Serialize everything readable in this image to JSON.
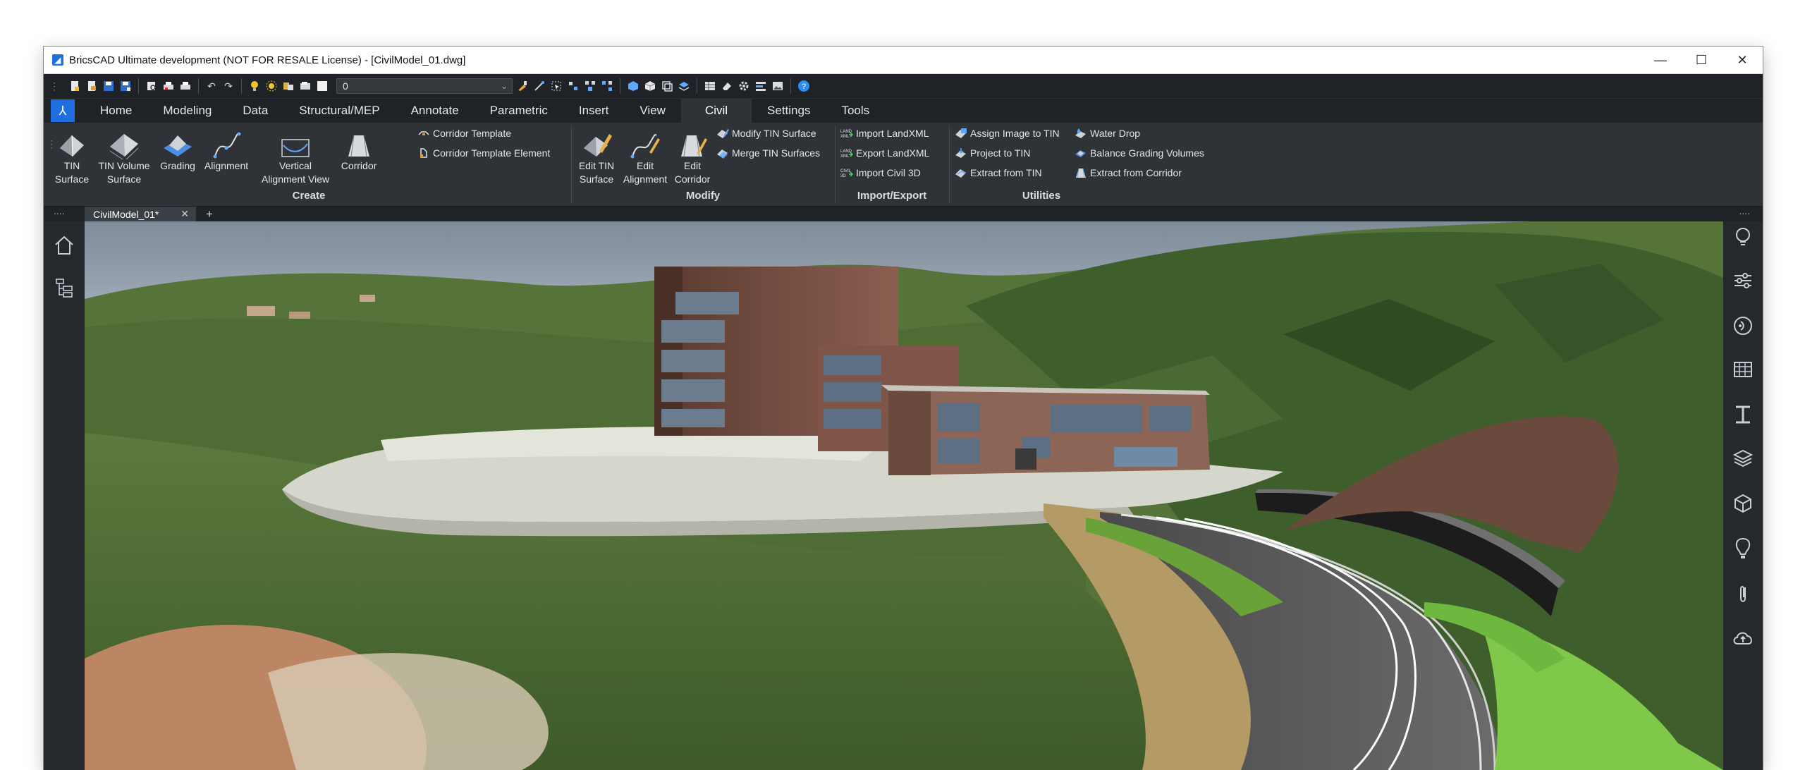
{
  "window": {
    "title": "BricsCAD Ultimate development (NOT FOR RESALE License) - [CivilModel_01.dwg]",
    "controls": {
      "minimize": "—",
      "maximize": "☐",
      "close": "✕"
    }
  },
  "qat": {
    "layer_value": "0",
    "icons": [
      "new-icon",
      "open-icon",
      "save-icon",
      "save-as-icon",
      "print-preview-icon",
      "plot-icon",
      "print-icon",
      "undo-icon",
      "redo-icon",
      "light-icon",
      "sun-icon",
      "layer-props-icon",
      "layer-state-icon",
      "color-swatch-icon",
      "match-props-icon",
      "pick-icon",
      "select-icon",
      "quick-select-icon",
      "select-similar-icon",
      "grip-icon",
      "view-cube-icon",
      "solid-icon",
      "render-icon",
      "layers-icon",
      "table-icon",
      "eraser-icon",
      "settings-icon",
      "draw-order-icon",
      "image-icon",
      "help-icon"
    ]
  },
  "tabs": [
    "Home",
    "Modeling",
    "Data",
    "Structural/MEP",
    "Annotate",
    "Parametric",
    "Insert",
    "View",
    "Civil",
    "Settings",
    "Tools"
  ],
  "active_tab": "Civil",
  "ribbon": {
    "create": {
      "title": "Create",
      "buttons": [
        {
          "label1": "TIN",
          "label2": "Surface"
        },
        {
          "label1": "TIN Volume",
          "label2": "Surface"
        },
        {
          "label1": "Grading",
          "label2": ""
        },
        {
          "label1": "Alignment",
          "label2": ""
        },
        {
          "label1": "Vertical",
          "label2": "Alignment View"
        },
        {
          "label1": "Corridor",
          "label2": ""
        }
      ],
      "small": [
        "Corridor Template",
        "Corridor Template Element"
      ]
    },
    "modify": {
      "title": "Modify",
      "buttons": [
        {
          "label1": "Edit TIN",
          "label2": "Surface"
        },
        {
          "label1": "Edit",
          "label2": "Alignment"
        },
        {
          "label1": "Edit",
          "label2": "Corridor"
        }
      ],
      "small": [
        "Modify TIN Surface",
        "Merge TIN Surfaces"
      ]
    },
    "import_export": {
      "title": "Import/Export",
      "small": [
        "Import LandXML",
        "Export LandXML",
        "Import Civil 3D"
      ]
    },
    "utilities": {
      "title": "Utilities",
      "small_col1": [
        "Assign Image to TIN",
        "Project to TIN",
        "Extract from TIN"
      ],
      "small_col2": [
        "Water Drop",
        "Balance Grading Volumes",
        "Extract from Corridor"
      ]
    }
  },
  "doc": {
    "tab_label": "CivilModel_01*",
    "close": "✕",
    "add": "+",
    "dots": "...."
  },
  "colors": {
    "accent": "#1f6fe0",
    "ribbon_bg": "#2f3338",
    "toolbar_bg": "#1f2226"
  }
}
